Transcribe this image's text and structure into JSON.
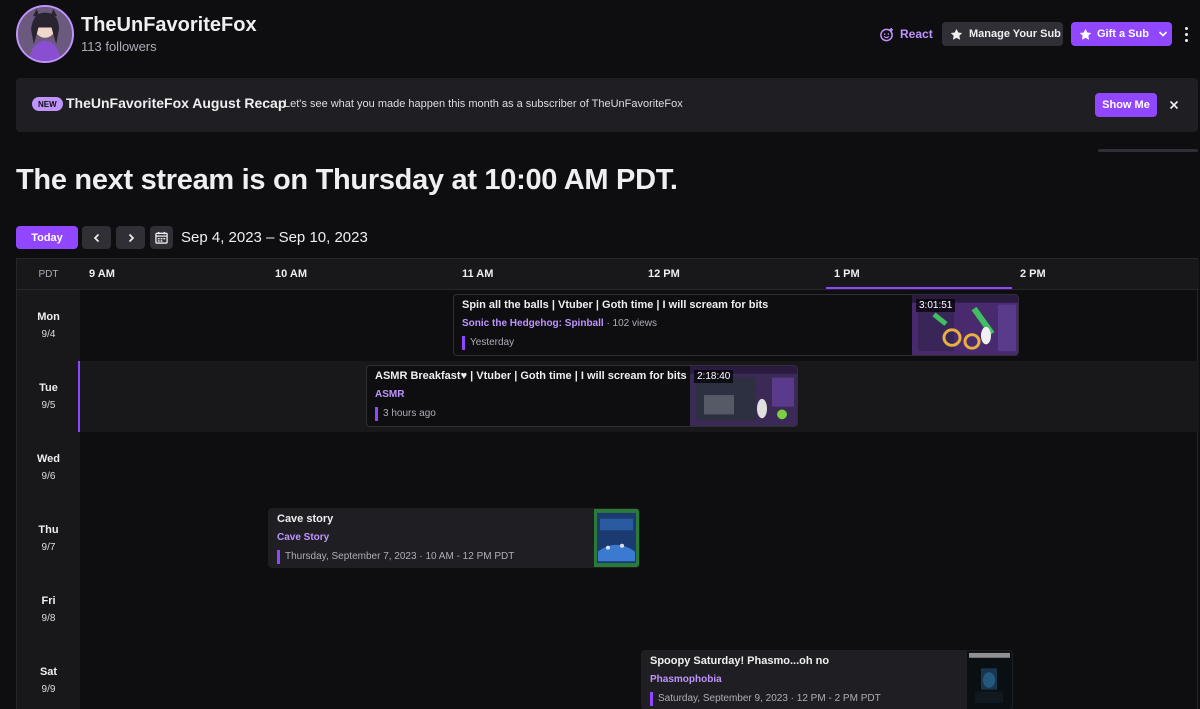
{
  "header": {
    "channel_name": "TheUnFavoriteFox",
    "followers": "113 followers",
    "react_label": "React",
    "manage_label": "Manage Your Sub",
    "gift_label": "Gift a Sub"
  },
  "banner": {
    "badge": "NEW",
    "title": "TheUnFavoriteFox August Recap",
    "text": "Let's see what you made happen this month as a subscriber of TheUnFavoriteFox",
    "button": "Show Me"
  },
  "next_stream": "The next stream is on Thursday at 10:00 AM PDT.",
  "controls": {
    "today_label": "Today",
    "date_range": "Sep 4, 2023 – Sep 10, 2023"
  },
  "schedule": {
    "timezone": "PDT",
    "hours": [
      "9 AM",
      "10 AM",
      "11 AM",
      "12 PM",
      "1 PM",
      "2 PM"
    ],
    "days": [
      {
        "name": "Mon",
        "date": "9/4"
      },
      {
        "name": "Tue",
        "date": "9/5"
      },
      {
        "name": "Wed",
        "date": "9/6"
      },
      {
        "name": "Thu",
        "date": "9/7"
      },
      {
        "name": "Fri",
        "date": "9/8"
      },
      {
        "name": "Sat",
        "date": "9/9"
      }
    ],
    "events": [
      {
        "title": "Spin all the balls | Vtuber | Goth time | I will scream for bits",
        "game": "Sonic the Hedgehog: Spinball",
        "views": "· 102 views",
        "meta": "Yesterday",
        "duration": "3:01:51"
      },
      {
        "title": "ASMR Breakfast♥ | Vtuber | Goth time | I will scream for bits",
        "game": "ASMR",
        "meta": "3 hours ago",
        "duration": "2:18:40"
      },
      {
        "title": "Cave story",
        "game": "Cave Story",
        "meta": "Thursday, September 7, 2023 · 10 AM - 12 PM PDT"
      },
      {
        "title": "Spoopy Saturday! Phasmo...oh no",
        "game": "Phasmophobia",
        "meta": "Saturday, September 9, 2023 · 12 PM - 2 PM PDT"
      }
    ]
  },
  "colors": {
    "accent": "#9147ff",
    "accent_light": "#bf94ff",
    "background": "#0e0e10",
    "surface": "#18181b"
  }
}
